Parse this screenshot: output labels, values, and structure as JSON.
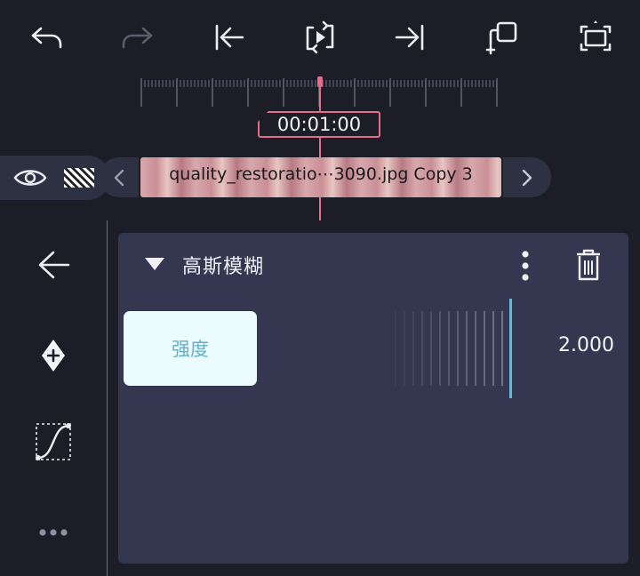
{
  "toolbar": {
    "buttons": [
      {
        "name": "undo",
        "icon": "undo-icon"
      },
      {
        "name": "redo",
        "icon": "redo-icon",
        "enabled": false
      },
      {
        "name": "jump-to-start",
        "icon": "skip-to-start-icon"
      },
      {
        "name": "play-loop",
        "icon": "loop-play-icon"
      },
      {
        "name": "jump-to-end",
        "icon": "skip-to-end-icon"
      },
      {
        "name": "add-keyframe-layer",
        "icon": "copy-add-icon"
      },
      {
        "name": "fullscreen",
        "icon": "fullscreen-icon"
      }
    ]
  },
  "timeline": {
    "timecode": "00:01:00",
    "clip_label": "quality_restoratio⋯3090.jpg Copy 3"
  },
  "effect": {
    "title": "高斯模糊",
    "param_label": "强度",
    "param_value": "2.000"
  },
  "colors": {
    "background": "#1c1d27",
    "panel": "#353750",
    "playhead": "#e46d8c",
    "slider_indicator": "#4fc3e0",
    "param_label_bg": "#ecfbfd",
    "param_label_text": "#5fb2c7"
  },
  "side_tools": [
    {
      "name": "back",
      "icon": "arrow-left-icon"
    },
    {
      "name": "add-keyframe",
      "icon": "keyframe-add-icon"
    },
    {
      "name": "curve",
      "icon": "curve-icon"
    },
    {
      "name": "more",
      "icon": "more-horizontal-icon"
    }
  ]
}
